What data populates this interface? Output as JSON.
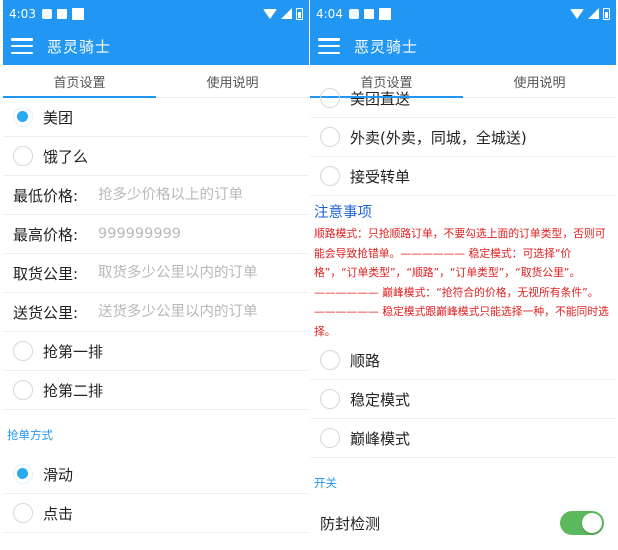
{
  "app": {
    "title": "恶灵骑士"
  },
  "left": {
    "status": {
      "time": "4:03"
    },
    "tabs": [
      {
        "label": "首页设置",
        "active": true
      },
      {
        "label": "使用说明",
        "active": false
      }
    ],
    "platforms": [
      {
        "label": "美团",
        "checked": true
      },
      {
        "label": "饿了么",
        "checked": false
      }
    ],
    "fields": [
      {
        "label": "最低价格:",
        "placeholder": "抢多少价格以上的订单"
      },
      {
        "label": "最高价格:",
        "placeholder": "999999999"
      },
      {
        "label": "取货公里:",
        "placeholder": "取货多少公里以内的订单"
      },
      {
        "label": "送货公里:",
        "placeholder": "送货多少公里以内的订单"
      }
    ],
    "queue": [
      {
        "label": "抢第一排",
        "checked": false
      },
      {
        "label": "抢第二排",
        "checked": false
      }
    ],
    "grab_method_label": "抢单方式",
    "methods": [
      {
        "label": "滑动",
        "checked": true
      },
      {
        "label": "点击",
        "checked": false
      }
    ]
  },
  "right": {
    "status": {
      "time": "4:04"
    },
    "tabs": [
      {
        "label": "首页设置",
        "active": true
      },
      {
        "label": "使用说明",
        "active": false
      }
    ],
    "order_types": [
      {
        "label": "美团直送",
        "checked": false
      },
      {
        "label": "外卖(外卖，同城，全城送)",
        "checked": false
      },
      {
        "label": "接受转单",
        "checked": false
      }
    ],
    "notice_title": "注意事项",
    "notice_text": "顺路模式：只抢顺路订单，不要勾选上面的订单类型，否则可能会导致抢错单。—————— 稳定模式：可选择“价格”，“订单类型”，“顺路”，“订单类型”，“取货公里”。—————— 巅峰模式：“抢符合的价格，无视所有条件”。—————— 稳定模式跟巅峰模式只能选择一种，不能同时选择。",
    "modes": [
      {
        "label": "顺路",
        "checked": false
      },
      {
        "label": "稳定模式",
        "checked": false
      },
      {
        "label": "巅峰模式",
        "checked": false
      }
    ],
    "switch_section_label": "开关",
    "anti_ban": {
      "label": "防封检测",
      "on": true
    },
    "switch_color": "#5cb85c"
  },
  "colors": {
    "primary": "#2196f3",
    "radio_checked": "#29a9ef",
    "notice_title": "#1e63d6",
    "notice_text": "#e02020"
  }
}
